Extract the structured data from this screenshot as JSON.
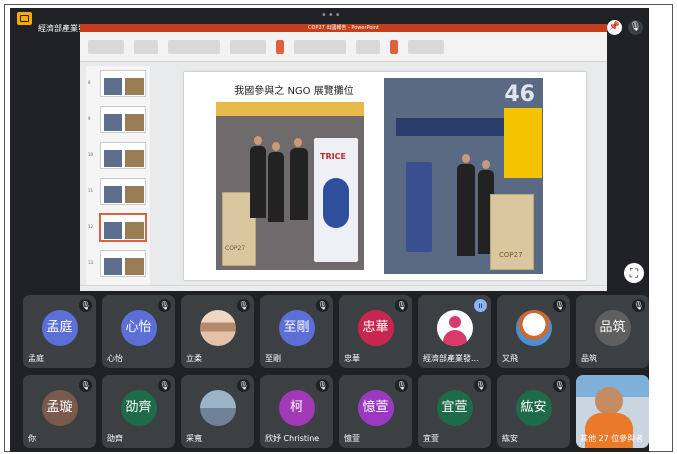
{
  "meeting": {
    "share_label": "經濟部產業發展署陳偉鐸正在分享螢幕畫面",
    "more_dots": "•••"
  },
  "presentation": {
    "window_title": "COP27 出國報告 - PowerPoint",
    "slide_title": "我國參與之 NGO 展覽攤位",
    "photo1_banner": "TRICE",
    "photo1_sign": "COP27",
    "photo2_number": "46",
    "photo2_sign": "COP27",
    "thumbnail_numbers": [
      "8",
      "9",
      "10",
      "11",
      "12",
      "13"
    ],
    "selected_thumbnail": 5
  },
  "icons": {
    "share": "present-to-all-icon",
    "pin": "pin-icon",
    "mic_off": "mic-off-icon",
    "talking": "audio-level-icon",
    "fullscreen": "fullscreen-icon"
  },
  "glyphs": {
    "mute": "🎙",
    "pin": "📌",
    "talk": "ıı",
    "fullscreen": "⛶"
  },
  "participants": [
    {
      "avatar_text": "孟庭",
      "name": "孟庭",
      "color": "#5b6fd6",
      "muted": true
    },
    {
      "avatar_text": "心怡",
      "name": "心怡",
      "color": "#5b6fd6",
      "muted": true
    },
    {
      "avatar_text": "",
      "name": "立柔",
      "color": "#f1d6c4",
      "muted": true,
      "photo": true
    },
    {
      "avatar_text": "至剛",
      "name": "至剛",
      "color": "#5b6fd6",
      "muted": true
    },
    {
      "avatar_text": "忠華",
      "name": "忠華",
      "color": "#c9264f",
      "muted": true
    },
    {
      "avatar_text": "",
      "name": "經濟部產業發...",
      "color": "#ffffff",
      "muted": false,
      "talking": true
    },
    {
      "avatar_text": "",
      "name": "又飛",
      "color": "#4a90d9",
      "muted": true,
      "photo": true
    },
    {
      "avatar_text": "品筑",
      "name": "品筑",
      "color": "#5f5f5f",
      "muted": true
    },
    {
      "avatar_text": "孟璇",
      "name": "你",
      "color": "#7a5a4a",
      "muted": true
    },
    {
      "avatar_text": "劭齊",
      "name": "劭齊",
      "color": "#1e6b4a",
      "muted": true
    },
    {
      "avatar_text": "",
      "name": "采寬",
      "color": "#9ab3c7",
      "muted": true,
      "photo": true
    },
    {
      "avatar_text": "柯",
      "name": "欣妤 Christine",
      "color": "#a23ab8",
      "muted": true
    },
    {
      "avatar_text": "憶萱",
      "name": "憶萱",
      "color": "#9b3ac0",
      "muted": true
    },
    {
      "avatar_text": "宜萱",
      "name": "宜萱",
      "color": "#1e6b4a",
      "muted": true
    },
    {
      "avatar_text": "紘安",
      "name": "紘安",
      "color": "#1e6b4a",
      "muted": true
    }
  ],
  "others_tile": {
    "label": "其他 27 位參與者"
  }
}
